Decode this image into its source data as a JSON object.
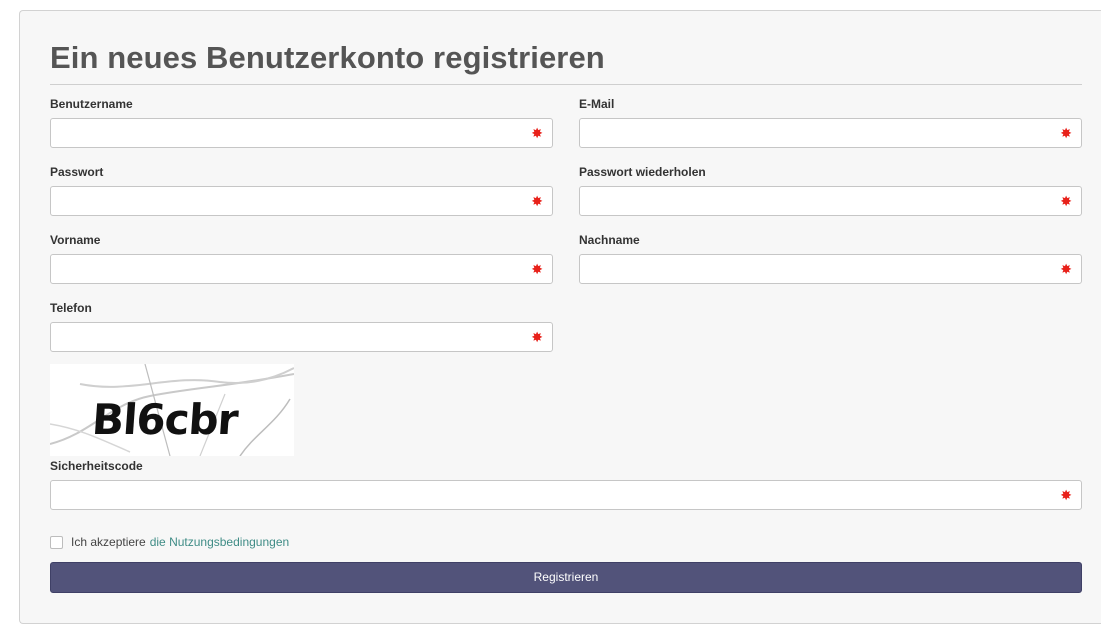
{
  "form": {
    "title": "Ein neues Benutzerkonto registrieren",
    "required_marker": "✸",
    "fields": {
      "username": {
        "label": "Benutzername",
        "value": ""
      },
      "email": {
        "label": "E-Mail",
        "value": ""
      },
      "password": {
        "label": "Passwort",
        "value": ""
      },
      "password_repeat": {
        "label": "Passwort wiederholen",
        "value": ""
      },
      "firstname": {
        "label": "Vorname",
        "value": ""
      },
      "lastname": {
        "label": "Nachname",
        "value": ""
      },
      "phone": {
        "label": "Telefon",
        "value": ""
      },
      "security_code": {
        "label": "Sicherheitscode",
        "value": ""
      }
    },
    "captcha": {
      "text": "Bl6cbr"
    },
    "terms": {
      "checked": false,
      "text": "Ich akzeptiere",
      "link": "die Nutzungsbedingungen"
    },
    "submit_label": "Registrieren"
  },
  "colors": {
    "button": "#52537a",
    "required": "#e8211a",
    "link": "#3f8c86"
  }
}
